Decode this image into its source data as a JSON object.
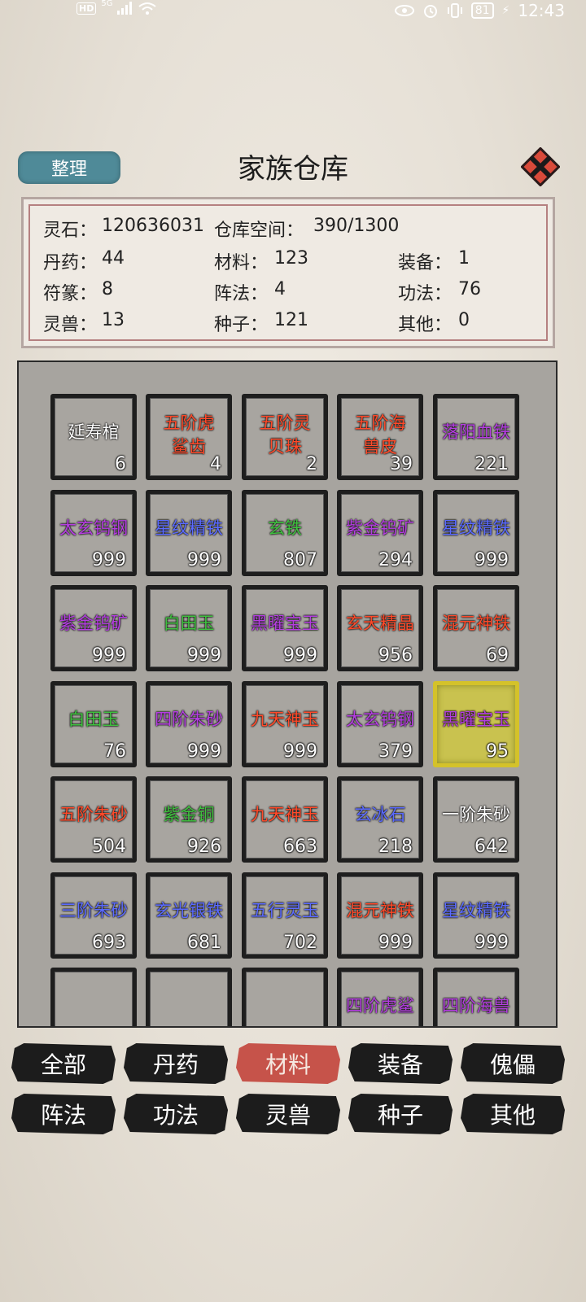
{
  "status_bar": {
    "network": "HD",
    "signal": "5G",
    "battery": "81",
    "time": "12:43"
  },
  "header": {
    "sort_label": "整理",
    "title": "家族仓库"
  },
  "info": {
    "lingshi_label": "灵石：",
    "lingshi_value": "120636031",
    "space_label": "仓库空间：",
    "space_value": "390/1300",
    "rows": [
      [
        {
          "label": "丹药：",
          "value": "44"
        },
        {
          "label": "材料：",
          "value": "123"
        },
        {
          "label": "装备：",
          "value": "1"
        }
      ],
      [
        {
          "label": "符篆：",
          "value": "8"
        },
        {
          "label": "阵法：",
          "value": "4"
        },
        {
          "label": "功法：",
          "value": "76"
        }
      ],
      [
        {
          "label": "灵兽：",
          "value": "13"
        },
        {
          "label": "种子：",
          "value": "121"
        },
        {
          "label": "其他：",
          "value": "0"
        }
      ]
    ]
  },
  "items": [
    {
      "name": "延寿棺",
      "count": "6",
      "color": "#ffffff"
    },
    {
      "name": "五阶虎鲨齿",
      "count": "4",
      "color": "#ff4a2a"
    },
    {
      "name": "五阶灵贝珠",
      "count": "2",
      "color": "#ff4a2a"
    },
    {
      "name": "五阶海兽皮",
      "count": "39",
      "color": "#ff4a2a"
    },
    {
      "name": "落阳血铁",
      "count": "221",
      "color": "#b43ee0"
    },
    {
      "name": "太玄钨钢",
      "count": "999",
      "color": "#b43ee0"
    },
    {
      "name": "星纹精铁",
      "count": "999",
      "color": "#5b6bff"
    },
    {
      "name": "玄铁",
      "count": "807",
      "color": "#3fbf3f"
    },
    {
      "name": "紫金钨矿",
      "count": "294",
      "color": "#b43ee0"
    },
    {
      "name": "星纹精铁",
      "count": "999",
      "color": "#5b6bff"
    },
    {
      "name": "紫金钨矿",
      "count": "999",
      "color": "#b43ee0"
    },
    {
      "name": "白田玉",
      "count": "999",
      "color": "#3fbf3f"
    },
    {
      "name": "黑曜宝玉",
      "count": "999",
      "color": "#b43ee0"
    },
    {
      "name": "玄天精晶",
      "count": "956",
      "color": "#ff4a2a"
    },
    {
      "name": "混元神铁",
      "count": "69",
      "color": "#ff4a2a"
    },
    {
      "name": "白田玉",
      "count": "76",
      "color": "#3fbf3f"
    },
    {
      "name": "四阶朱砂",
      "count": "999",
      "color": "#b43ee0"
    },
    {
      "name": "九天神玉",
      "count": "999",
      "color": "#ff4a2a"
    },
    {
      "name": "太玄钨钢",
      "count": "379",
      "color": "#b43ee0"
    },
    {
      "name": "黑曜宝玉",
      "count": "95",
      "color": "#b43ee0",
      "selected": true
    },
    {
      "name": "五阶朱砂",
      "count": "504",
      "color": "#ff4a2a"
    },
    {
      "name": "紫金铜",
      "count": "926",
      "color": "#3fbf3f"
    },
    {
      "name": "九天神玉",
      "count": "663",
      "color": "#ff4a2a"
    },
    {
      "name": "玄冰石",
      "count": "218",
      "color": "#5b6bff"
    },
    {
      "name": "一阶朱砂",
      "count": "642",
      "color": "#ffffff"
    },
    {
      "name": "三阶朱砂",
      "count": "693",
      "color": "#5b6bff"
    },
    {
      "name": "玄光银铁",
      "count": "681",
      "color": "#5b6bff"
    },
    {
      "name": "五行灵玉",
      "count": "702",
      "color": "#5b6bff"
    },
    {
      "name": "混元神铁",
      "count": "999",
      "color": "#ff4a2a"
    },
    {
      "name": "星纹精铁",
      "count": "999",
      "color": "#5b6bff"
    },
    {
      "name": "",
      "count": "",
      "color": "#ffffff"
    },
    {
      "name": "",
      "count": "",
      "color": "#ffffff"
    },
    {
      "name": "",
      "count": "",
      "color": "#ffffff"
    },
    {
      "name": "四阶虎鲨",
      "count": "",
      "color": "#b43ee0"
    },
    {
      "name": "四阶海兽",
      "count": "",
      "color": "#b43ee0"
    }
  ],
  "tabs_row1": [
    {
      "label": "全部",
      "active": false
    },
    {
      "label": "丹药",
      "active": false
    },
    {
      "label": "材料",
      "active": true
    },
    {
      "label": "装备",
      "active": false
    },
    {
      "label": "傀儡",
      "active": false
    }
  ],
  "tabs_row2": [
    {
      "label": "阵法",
      "active": false
    },
    {
      "label": "功法",
      "active": false
    },
    {
      "label": "灵兽",
      "active": false
    },
    {
      "label": "种子",
      "active": false
    },
    {
      "label": "其他",
      "active": false
    }
  ]
}
